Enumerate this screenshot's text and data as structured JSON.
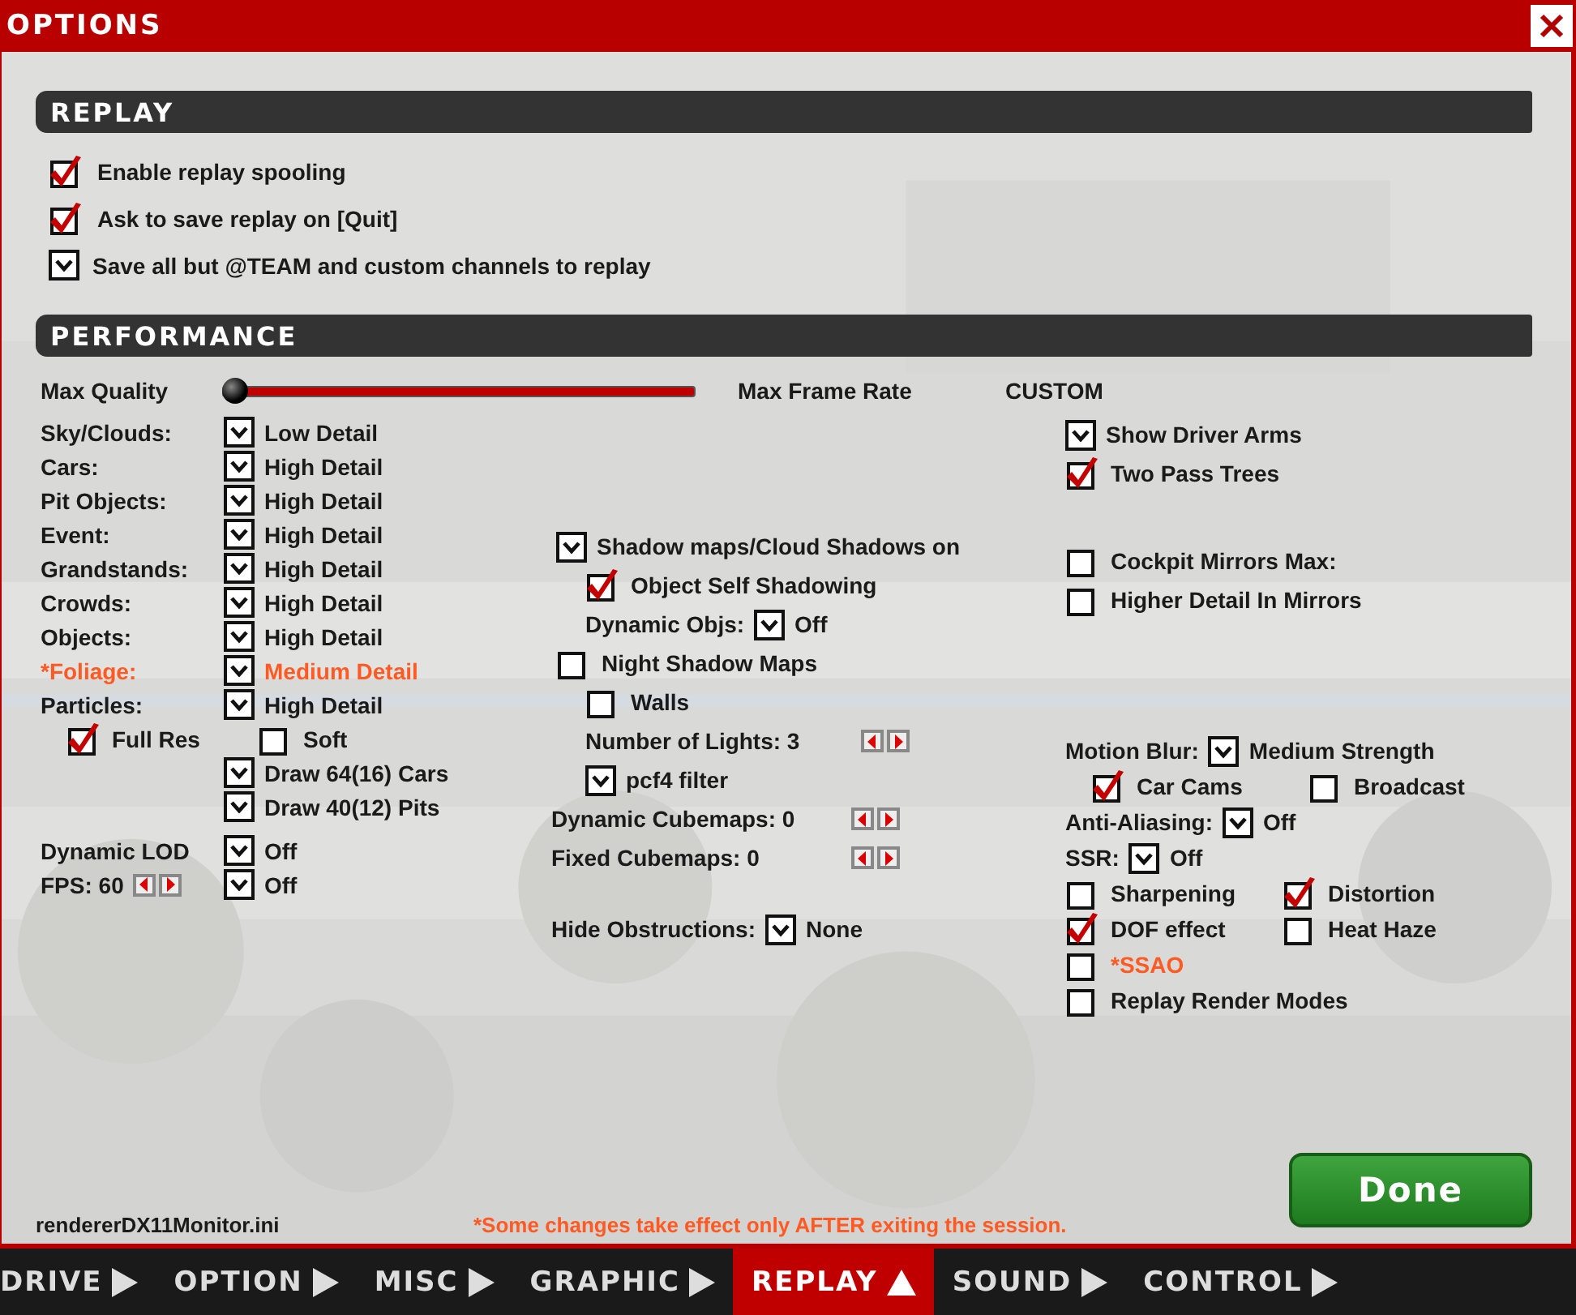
{
  "window": {
    "title": "OPTIONS"
  },
  "replay": {
    "title": "REPLAY",
    "options": [
      {
        "kind": "check",
        "checked": true,
        "label": "Enable replay spooling"
      },
      {
        "kind": "check",
        "checked": true,
        "label": "Ask to save replay on [Quit]"
      },
      {
        "kind": "dropdown",
        "label": "Save all but @TEAM and custom channels to replay"
      }
    ]
  },
  "performance": {
    "title": "PERFORMANCE",
    "quality": {
      "min_label": "Max Quality",
      "level": 0,
      "max_label": "Max Frame Rate",
      "preset": "CUSTOM"
    },
    "columns": [
      {
        "groups": [
          {
            "kind": "table",
            "rows": [
              {
                "parts": [
                  {
                    "kind": "text",
                    "text": "Sky/Clouds:"
                  },
                  {
                    "kind": "dropdown"
                  },
                  {
                    "kind": "text",
                    "text": "Low Detail"
                  }
                ]
              },
              {
                "parts": [
                  {
                    "kind": "text",
                    "text": "Cars:"
                  },
                  {
                    "kind": "dropdown"
                  },
                  {
                    "kind": "text",
                    "text": "High Detail"
                  }
                ]
              },
              {
                "parts": [
                  {
                    "kind": "text",
                    "text": "Pit Objects:"
                  },
                  {
                    "kind": "dropdown"
                  },
                  {
                    "kind": "text",
                    "text": "High Detail"
                  }
                ]
              },
              {
                "parts": [
                  {
                    "kind": "text",
                    "text": "Event:"
                  },
                  {
                    "kind": "dropdown"
                  },
                  {
                    "kind": "text",
                    "text": "High Detail"
                  }
                ]
              },
              {
                "parts": [
                  {
                    "kind": "text",
                    "text": "Grandstands:"
                  },
                  {
                    "kind": "dropdown"
                  },
                  {
                    "kind": "text",
                    "text": "High Detail"
                  }
                ]
              },
              {
                "parts": [
                  {
                    "kind": "text",
                    "text": "Crowds:"
                  },
                  {
                    "kind": "dropdown"
                  },
                  {
                    "kind": "text",
                    "text": "High Detail"
                  }
                ]
              },
              {
                "parts": [
                  {
                    "kind": "text",
                    "text": "Objects:"
                  },
                  {
                    "kind": "dropdown"
                  },
                  {
                    "kind": "text",
                    "text": "High Detail"
                  }
                ]
              },
              {
                "parts": [
                  {
                    "kind": "text",
                    "text": "*Foliage:",
                    "warning": true
                  },
                  {
                    "kind": "dropdown"
                  },
                  {
                    "kind": "text",
                    "text": "Medium Detail",
                    "warning": true
                  }
                ]
              },
              {
                "parts": [
                  {
                    "kind": "text",
                    "text": "Particles:"
                  },
                  {
                    "kind": "dropdown"
                  },
                  {
                    "kind": "text",
                    "text": "High Detail"
                  }
                ]
              }
            ]
          },
          {
            "kind": "list",
            "rows": [
              {
                "parts": [
                  {
                    "kind": "check",
                    "checked": true
                  },
                  {
                    "kind": "text",
                    "text": "Full Res"
                  },
                  {
                    "kind": "check",
                    "checked": false
                  },
                  {
                    "kind": "text",
                    "text": "Soft"
                  }
                ]
              }
            ]
          },
          {
            "kind": "list",
            "rows": [
              {
                "parts": [
                  {
                    "kind": "dropdown"
                  },
                  {
                    "kind": "text",
                    "text": "Draw 64(16) Cars"
                  }
                ]
              },
              {
                "parts": [
                  {
                    "kind": "dropdown"
                  },
                  {
                    "kind": "text",
                    "text": "Draw 40(12) Pits"
                  }
                ]
              }
            ]
          },
          {
            "kind": "table",
            "rows": [
              {
                "parts": [
                  {
                    "kind": "text",
                    "text": "Dynamic LOD"
                  },
                  {
                    "kind": "dropdown"
                  },
                  {
                    "kind": "text",
                    "text": "Off"
                  }
                ]
              },
              {
                "parts": [
                  {
                    "kind": "text",
                    "text": "FPS: 60"
                  },
                  {
                    "kind": "stepper"
                  },
                  {
                    "kind": "dropdown"
                  },
                  {
                    "kind": "text",
                    "text": "Off"
                  }
                ]
              }
            ]
          }
        ]
      },
      {
        "groups": [
          {
            "kind": "list",
            "rows": [
              {
                "parts": [
                  {
                    "kind": "dropdown"
                  },
                  {
                    "kind": "text",
                    "text": "Shadow maps/Cloud Shadows on"
                  }
                ],
                "children": [
                  {
                    "parts": [
                      {
                        "kind": "check",
                        "checked": true
                      },
                      {
                        "kind": "text",
                        "text": "Object Self Shadowing"
                      }
                    ]
                  },
                  {
                    "parts": [
                      {
                        "kind": "text",
                        "text": "Dynamic Objs:"
                      },
                      {
                        "kind": "dropdown"
                      },
                      {
                        "kind": "text",
                        "text": "Off"
                      }
                    ]
                  }
                ]
              },
              {
                "parts": [
                  {
                    "kind": "check",
                    "checked": false
                  },
                  {
                    "kind": "text",
                    "text": "Night Shadow Maps"
                  }
                ],
                "children": [
                  {
                    "parts": [
                      {
                        "kind": "check",
                        "checked": false
                      },
                      {
                        "kind": "text",
                        "text": "Walls"
                      }
                    ]
                  },
                  {
                    "parts": [
                      {
                        "kind": "text",
                        "text": "Number of Lights: 3"
                      },
                      {
                        "kind": "stepper"
                      }
                    ]
                  },
                  {
                    "parts": [
                      {
                        "kind": "dropdown"
                      },
                      {
                        "kind": "text",
                        "text": "pcf4 filter"
                      }
                    ]
                  }
                ]
              }
            ]
          },
          {
            "kind": "list",
            "rows": [
              {
                "parts": [
                  {
                    "kind": "text",
                    "text": "Dynamic Cubemaps: 0"
                  },
                  {
                    "kind": "stepper"
                  }
                ]
              },
              {
                "parts": [
                  {
                    "kind": "text",
                    "text": "Fixed Cubemaps: 0"
                  },
                  {
                    "kind": "stepper"
                  }
                ]
              }
            ]
          },
          {
            "kind": "list",
            "rows": [
              {
                "parts": [
                  {
                    "kind": "text",
                    "text": "Hide Obstructions:"
                  },
                  {
                    "kind": "dropdown"
                  },
                  {
                    "kind": "text",
                    "text": "None"
                  }
                ]
              }
            ]
          }
        ]
      },
      {
        "groups": [
          {
            "kind": "list",
            "rows": [
              {
                "parts": [
                  {
                    "kind": "dropdown"
                  },
                  {
                    "kind": "text",
                    "text": "Show Driver Arms"
                  }
                ]
              },
              {
                "parts": [
                  {
                    "kind": "check",
                    "checked": true
                  },
                  {
                    "kind": "text",
                    "text": "Two Pass Trees"
                  }
                ]
              }
            ]
          },
          {
            "kind": "list",
            "rows": [
              {
                "parts": [
                  {
                    "kind": "check",
                    "checked": false
                  },
                  {
                    "kind": "text",
                    "text": "Cockpit Mirrors  Max:"
                  }
                ]
              },
              {
                "parts": [
                  {
                    "kind": "check",
                    "checked": false
                  },
                  {
                    "kind": "text",
                    "text": "Higher Detail In Mirrors"
                  }
                ]
              }
            ]
          },
          {
            "kind": "list",
            "rows": [
              {
                "parts": [
                  {
                    "kind": "text",
                    "text": "Motion Blur:"
                  },
                  {
                    "kind": "dropdown"
                  },
                  {
                    "kind": "text",
                    "text": "Medium Strength"
                  }
                ],
                "children": [
                  {
                    "parts": [
                      {
                        "kind": "check",
                        "checked": true
                      },
                      {
                        "kind": "text",
                        "text": "Car Cams"
                      },
                      {
                        "kind": "check",
                        "checked": false
                      },
                      {
                        "kind": "text",
                        "text": "Broadcast"
                      }
                    ]
                  }
                ]
              },
              {
                "parts": [
                  {
                    "kind": "text",
                    "text": "Anti-Aliasing:"
                  },
                  {
                    "kind": "dropdown"
                  },
                  {
                    "kind": "text",
                    "text": "Off"
                  }
                ]
              },
              {
                "parts": [
                  {
                    "kind": "text",
                    "text": "SSR:"
                  },
                  {
                    "kind": "dropdown"
                  },
                  {
                    "kind": "text",
                    "text": "Off"
                  }
                ]
              },
              {
                "parts": [
                  {
                    "kind": "check",
                    "checked": false
                  },
                  {
                    "kind": "text",
                    "text": "Sharpening"
                  },
                  {
                    "kind": "check",
                    "checked": true
                  },
                  {
                    "kind": "text",
                    "text": "Distortion"
                  }
                ]
              },
              {
                "parts": [
                  {
                    "kind": "check",
                    "checked": true
                  },
                  {
                    "kind": "text",
                    "text": "DOF effect"
                  },
                  {
                    "kind": "check",
                    "checked": false
                  },
                  {
                    "kind": "text",
                    "text": "Heat Haze"
                  }
                ]
              },
              {
                "parts": [
                  {
                    "kind": "check",
                    "checked": false
                  },
                  {
                    "kind": "text",
                    "text": "*SSAO",
                    "warning": true
                  }
                ]
              },
              {
                "parts": [
                  {
                    "kind": "check",
                    "checked": false
                  },
                  {
                    "kind": "text",
                    "text": "Replay Render Modes"
                  }
                ]
              }
            ]
          }
        ]
      }
    ]
  },
  "footer": {
    "file": "rendererDX11Monitor.ini",
    "notice": "*Some changes take effect only AFTER exiting the session.",
    "done": "Done"
  },
  "tabs": [
    {
      "label": "DRIVE",
      "selected": false
    },
    {
      "label": "OPTION",
      "selected": false
    },
    {
      "label": "MISC",
      "selected": false
    },
    {
      "label": "GRAPHIC",
      "selected": false
    },
    {
      "label": "REPLAY",
      "selected": true
    },
    {
      "label": "SOUND",
      "selected": false
    },
    {
      "label": "CONTROL",
      "selected": false
    }
  ]
}
